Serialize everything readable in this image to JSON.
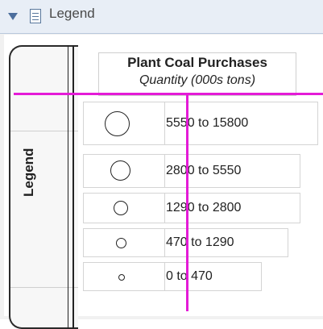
{
  "panel": {
    "title": "Legend",
    "icons": {
      "collapse": "triangle-down-icon",
      "document": "document-icon"
    }
  },
  "legend": {
    "tab_label": "Legend",
    "title": "Plant Coal Purchases",
    "subtitle": "Quantity (000s tons)",
    "entries": [
      {
        "label": "5550 to 15800",
        "symbol": "circle-icon"
      },
      {
        "label": "2800 to 5550",
        "symbol": "circle-icon"
      },
      {
        "label": "1290 to 2800",
        "symbol": "circle-icon"
      },
      {
        "label": "470 to 1290",
        "symbol": "circle-icon"
      },
      {
        "label": "0 to 470",
        "symbol": "circle-icon"
      }
    ]
  },
  "colors": {
    "header_bg": "#e8eef6",
    "arrow": "#4c6e9d",
    "guide_lines": "#e41bd7"
  }
}
